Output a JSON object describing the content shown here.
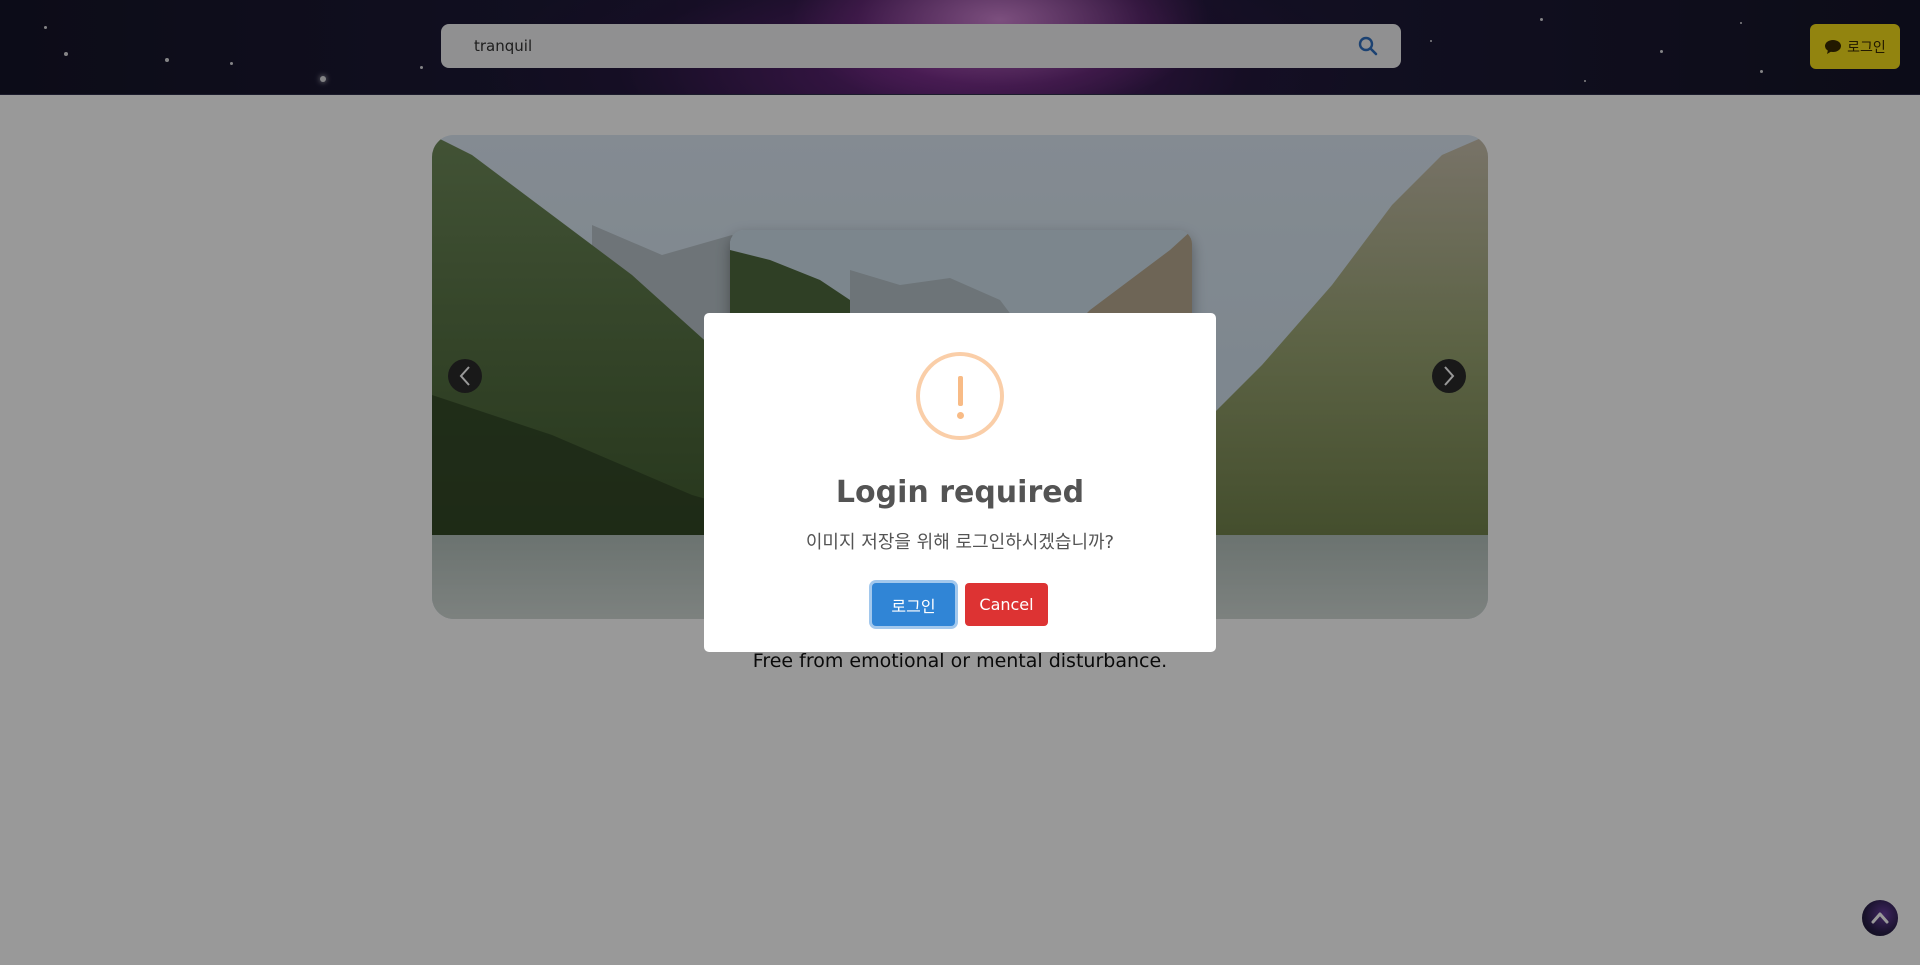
{
  "header": {
    "search": {
      "value": "tranquil",
      "icon": "search-icon"
    },
    "login_button": {
      "label": "로그인",
      "icon": "chat-bubble-icon",
      "color": "#f3dc1a"
    }
  },
  "main": {
    "carousel": {
      "prev_icon": "chevron-left-icon",
      "next_icon": "chevron-right-icon"
    },
    "caption": "Free from emotional or mental disturbance."
  },
  "modal": {
    "icon": "warning-icon",
    "title": "Login required",
    "text": "이미지 저장을 위해 로그인하시겠습니까?",
    "confirm_label": "로그인",
    "cancel_label": "Cancel",
    "confirm_color": "#3085d6",
    "cancel_color": "#dd3333"
  },
  "scroll_top": {
    "icon": "arrow-up-icon"
  }
}
